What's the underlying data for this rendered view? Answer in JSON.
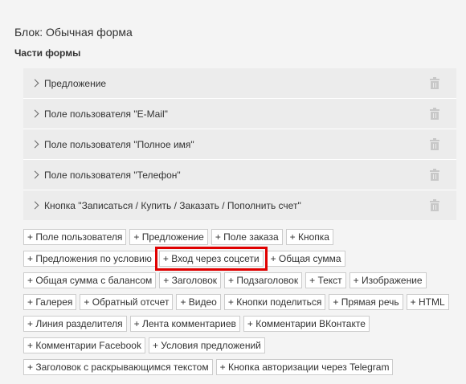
{
  "block": {
    "title": "Блок: Обычная форма",
    "parts_label": "Части формы"
  },
  "parts": [
    {
      "label": "Предложение"
    },
    {
      "label": "Поле пользователя \"E-Mail\""
    },
    {
      "label": "Поле пользователя \"Полное имя\""
    },
    {
      "label": "Поле пользователя \"Телефон\""
    },
    {
      "label": "Кнопка \"Записаться / Купить / Заказать / Пополнить счет\""
    }
  ],
  "add_buttons": [
    [
      "+ Поле пользователя",
      "+ Предложение",
      "+ Поле заказа",
      "+ Кнопка"
    ],
    [
      "+ Предложения по условию",
      "+ Вход через соцсети",
      "+ Общая сумма"
    ],
    [
      "+ Общая сумма с балансом",
      "+ Заголовок",
      "+ Подзаголовок",
      "+ Текст",
      "+ Изображение"
    ],
    [
      "+ Галерея",
      "+ Обратный отсчет",
      "+ Видео",
      "+ Кнопки поделиться",
      "+ Прямая речь",
      "+ HTML"
    ],
    [
      "+ Линия разделителя",
      "+ Лента комментариев",
      "+ Комментарии ВКонтакте"
    ],
    [
      "+ Комментарии Facebook",
      "+ Условия предложений"
    ],
    [
      "+ Заголовок с раскрывающимся текстом",
      "+ Кнопка авторизации через Telegram"
    ]
  ],
  "highlighted_button": "+ Вход через соцсети",
  "colors": {
    "highlight": "#e00000",
    "parts_bg": "#ececec",
    "page_bg": "#f4f4f4"
  },
  "icons": {
    "expand": "chevron-right-icon",
    "delete": "trash-icon"
  }
}
